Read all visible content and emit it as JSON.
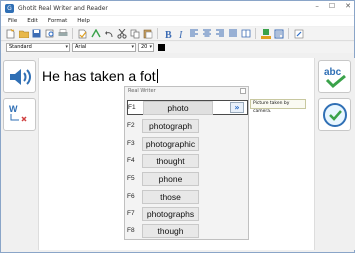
{
  "window": {
    "title": "Ghotit Real Writer and Reader",
    "minimize": "–",
    "maximize": "☐",
    "close": "✕"
  },
  "menu": [
    "File",
    "Edit",
    "Format",
    "Help"
  ],
  "format": {
    "style": "Standard",
    "font": "Arial",
    "size": "20"
  },
  "editor": {
    "text": "He has taken a fot"
  },
  "popup": {
    "title": "Real Writer",
    "more_symbol": "»",
    "tooltip": "Picture taken by camera.",
    "suggestions": [
      {
        "key": "F1",
        "word": "photo"
      },
      {
        "key": "F2",
        "word": "photograph"
      },
      {
        "key": "F3",
        "word": "photographic"
      },
      {
        "key": "F4",
        "word": "thought"
      },
      {
        "key": "F5",
        "word": "phone"
      },
      {
        "key": "F6",
        "word": "those"
      },
      {
        "key": "F7",
        "word": "photographs"
      },
      {
        "key": "F8",
        "word": "though"
      }
    ]
  },
  "side": {
    "check_label": "abc"
  },
  "colors": {
    "accent_blue": "#2f6fb5",
    "check_green": "#3aa24a",
    "selected_border": "#4a4a4a"
  }
}
